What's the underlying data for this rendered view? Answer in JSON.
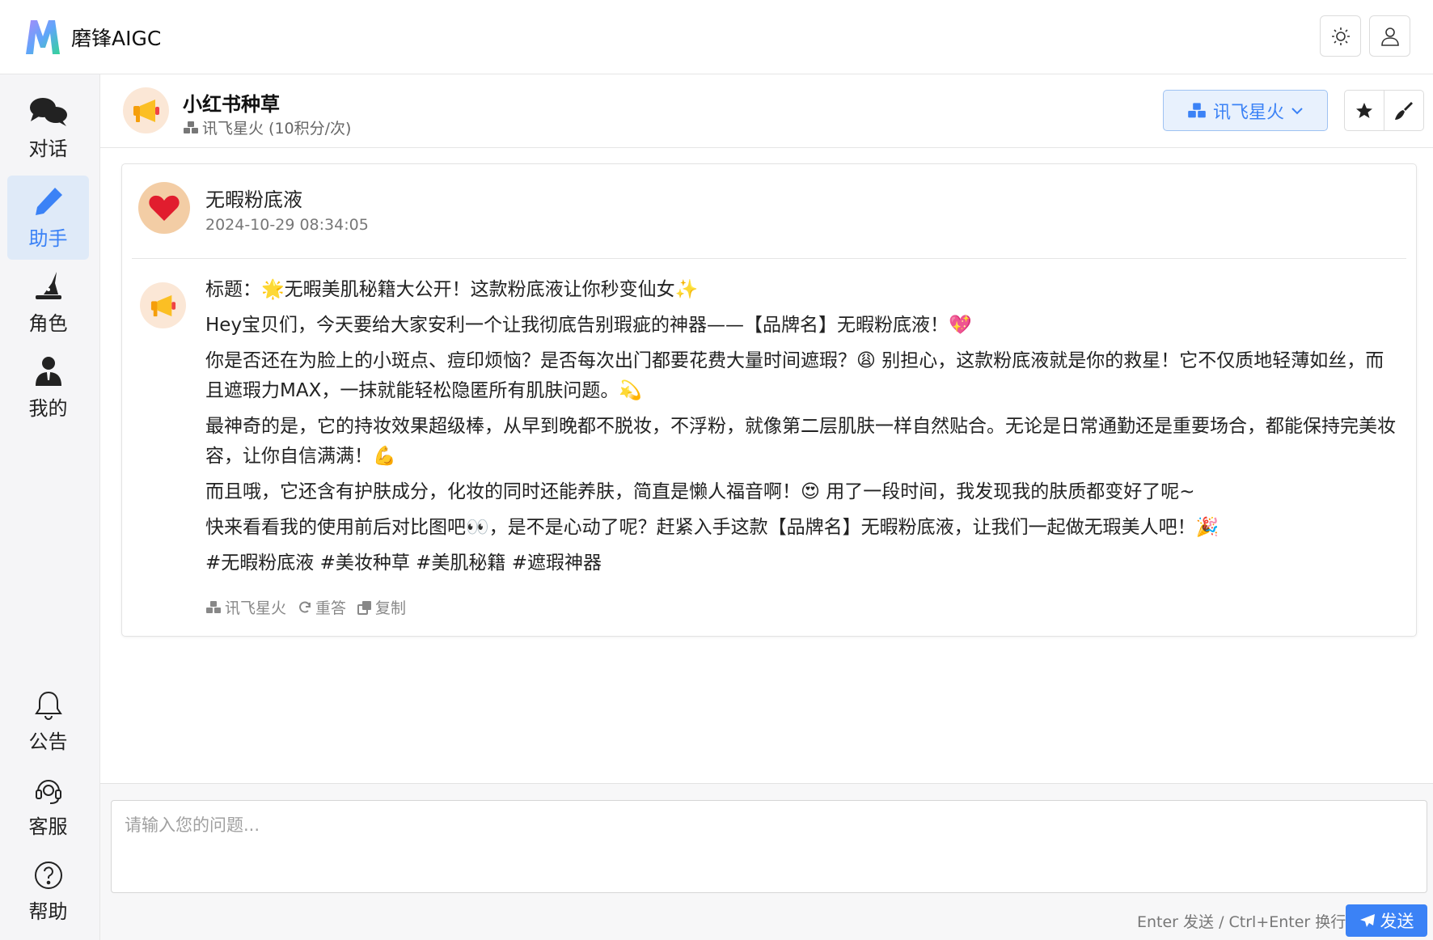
{
  "app": {
    "brand": "磨锋AIGC"
  },
  "sidebar": {
    "items": [
      {
        "label": "对话",
        "icon": "chat-bubbles-icon"
      },
      {
        "label": "助手",
        "icon": "pencil-icon",
        "active": true
      },
      {
        "label": "角色",
        "icon": "wizard-hat-icon"
      },
      {
        "label": "我的",
        "icon": "user-tie-icon"
      }
    ],
    "bottom_items": [
      {
        "label": "公告",
        "icon": "bell-icon"
      },
      {
        "label": "客服",
        "icon": "headset-icon"
      },
      {
        "label": "帮助",
        "icon": "help-circle-icon"
      }
    ]
  },
  "assistant": {
    "name": "小红书种草",
    "meta": "讯飞星火 (10积分/次)",
    "model": "讯飞星火"
  },
  "message": {
    "user_text": "无暇粉底液",
    "timestamp": "2024-10-29 08:34:05",
    "reply": [
      "标题：🌟无暇美肌秘籍大公开！这款粉底液让你秒变仙女✨",
      "Hey宝贝们，今天要给大家安利一个让我彻底告别瑕疵的神器——【品牌名】无暇粉底液！💖",
      "你是否还在为脸上的小斑点、痘印烦恼？是否每次出门都要花费大量时间遮瑕？😩 别担心，这款粉底液就是你的救星！它不仅质地轻薄如丝，而且遮瑕力MAX，一抹就能轻松隐匿所有肌肤问题。💫",
      "最神奇的是，它的持妆效果超级棒，从早到晚都不脱妆，不浮粉，就像第二层肌肤一样自然贴合。无论是日常通勤还是重要场合，都能保持完美妆容，让你自信满满！💪",
      "而且哦，它还含有护肤成分，化妆的同时还能养肤，简直是懒人福音啊！😍 用了一段时间，我发现我的肤质都变好了呢~",
      "快来看看我的使用前后对比图吧👀，是不是心动了呢？赶紧入手这款【品牌名】无暇粉底液，让我们一起做无瑕美人吧！🎉",
      "#无暇粉底液 #美妆种草 #美肌秘籍 #遮瑕神器"
    ],
    "actions": {
      "model": "讯飞星火",
      "retry": "重答",
      "copy": "复制"
    }
  },
  "input": {
    "placeholder": "请输入您的问题...",
    "hint": "Enter 发送 / Ctrl+Enter 换行",
    "send": "发送"
  },
  "colors": {
    "accent": "#3b82f6",
    "active_bg": "#dfeaf8"
  }
}
